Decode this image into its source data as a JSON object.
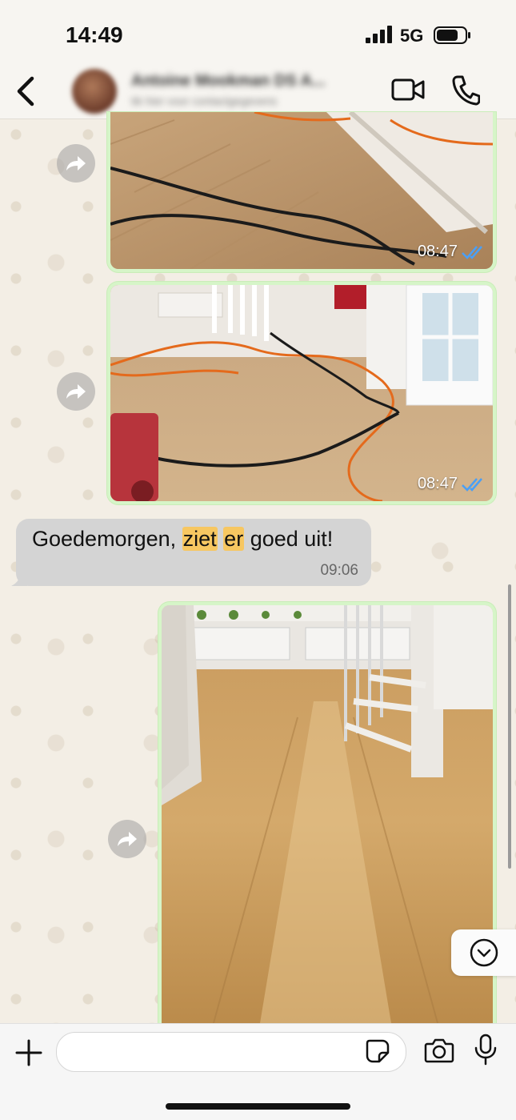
{
  "status_bar": {
    "time": "14:49",
    "network": "5G"
  },
  "header": {
    "contact_name": "Antoine Mookman DS A...",
    "contact_status": "tik hier voor contactgegevens",
    "icons": [
      "back-chevron-icon",
      "video-call-icon",
      "phone-call-icon"
    ]
  },
  "messages": [
    {
      "kind": "image",
      "direction": "outgoing",
      "time": "08:47",
      "read": true
    },
    {
      "kind": "image",
      "direction": "outgoing",
      "time": "08:47",
      "read": true
    },
    {
      "kind": "text",
      "direction": "incoming",
      "text_parts": [
        "Goedemorgen, ",
        "ziet",
        " ",
        "er",
        " goed uit!"
      ],
      "time": "09:06"
    },
    {
      "kind": "image",
      "direction": "outgoing",
      "time": "",
      "read": false
    }
  ],
  "composer": {
    "placeholder": ""
  },
  "colors": {
    "outgoing_border": "#d6f5c8",
    "incoming_bubble": "#d4d4d4",
    "highlight": "#f7c761",
    "read_ticks": "#4a9ff5"
  }
}
